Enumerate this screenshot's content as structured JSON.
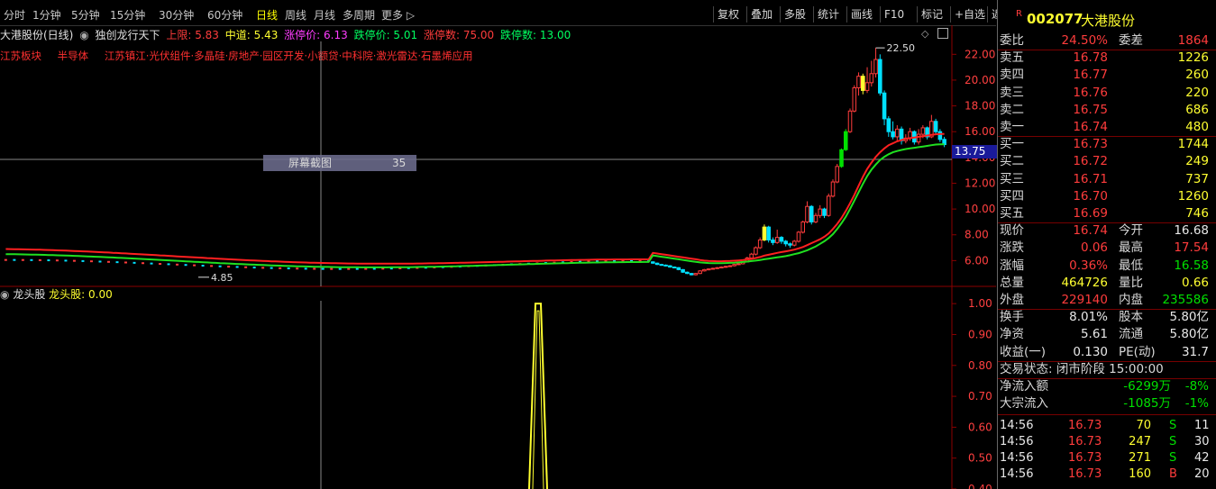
{
  "toolbar": {
    "tabs": [
      "分时",
      "1分钟",
      "5分钟",
      "15分钟",
      "30分钟",
      "60分钟",
      "日线",
      "周线",
      "月线",
      "多周期",
      "更多 ▷"
    ],
    "active_tab": "日线",
    "buttons": [
      "复权",
      "叠加",
      "多股",
      "统计",
      "画线",
      "F10",
      "标记",
      "+自选",
      "返回"
    ]
  },
  "chart_header": {
    "stock": "大港股份(日线)",
    "indicator": "独创龙行天下",
    "upper": "上限: 5.83",
    "middle": "中道: 5.43",
    "limit_up_price": "涨停价: 6.13",
    "limit_down_price": "跌停价: 5.01",
    "limit_up_count": "涨停数: 75.00",
    "limit_down_count": "跌停数: 13.00"
  },
  "sectors": [
    "江苏板块",
    "半导体",
    "江苏镇江·光伏组件·多晶硅·房地产·园区开发·小额贷·中科院·激光雷达·石墨烯应用"
  ],
  "tooltip": {
    "label": "屏幕截图",
    "value": "35"
  },
  "price_marks": {
    "high": "22.50",
    "low": "4.85",
    "current": "13.75"
  },
  "price_axis": [
    "22.00",
    "20.00",
    "18.00",
    "16.00",
    "14.00",
    "12.00",
    "10.00",
    "8.00",
    "6.00"
  ],
  "osc_header": {
    "name": "龙头股",
    "value": "龙头股: 0.00"
  },
  "osc_axis": [
    "1.00",
    "0.90",
    "0.80",
    "0.70",
    "0.60",
    "0.50",
    "0.40"
  ],
  "colors": {
    "up": "#ff3c3c",
    "down": "#00e0ff",
    "ma_red": "#ff2020",
    "ma_green": "#20e020",
    "osc": "#ffff30"
  },
  "chart_data": {
    "type": "candlestick",
    "y_range": [
      4.0,
      23.0
    ],
    "candles": [
      [
        5.9,
        5.8,
        5.95,
        5.75
      ],
      [
        5.8,
        5.7,
        5.85,
        5.65
      ],
      [
        5.7,
        5.65,
        5.75,
        5.6
      ],
      [
        5.65,
        5.6,
        5.7,
        5.55
      ],
      [
        5.6,
        5.5,
        5.65,
        5.45
      ],
      [
        5.5,
        5.45,
        5.55,
        5.4
      ],
      [
        5.45,
        5.3,
        5.5,
        5.25
      ],
      [
        5.3,
        5.1,
        5.35,
        5.05
      ],
      [
        5.1,
        5.0,
        5.15,
        4.95
      ],
      [
        5.0,
        4.9,
        5.05,
        4.85
      ],
      [
        4.9,
        5.0,
        5.05,
        4.85
      ],
      [
        5.0,
        5.2,
        5.25,
        4.95
      ],
      [
        5.2,
        5.3,
        5.35,
        5.15
      ],
      [
        5.3,
        5.35,
        5.4,
        5.25
      ],
      [
        5.35,
        5.4,
        5.45,
        5.3
      ],
      [
        5.4,
        5.45,
        5.5,
        5.35
      ],
      [
        5.45,
        5.5,
        5.55,
        5.4
      ],
      [
        5.5,
        5.55,
        5.6,
        5.45
      ],
      [
        5.55,
        5.6,
        5.65,
        5.5
      ],
      [
        5.6,
        5.7,
        5.75,
        5.55
      ],
      [
        5.7,
        5.75,
        5.8,
        5.65
      ],
      [
        5.75,
        5.9,
        5.95,
        5.7
      ],
      [
        5.9,
        6.2,
        6.3,
        5.85
      ],
      [
        6.2,
        6.5,
        6.6,
        6.1
      ],
      [
        6.5,
        7.0,
        7.1,
        6.4
      ],
      [
        7.0,
        7.6,
        7.8,
        6.9
      ],
      [
        7.6,
        8.6,
        8.8,
        7.5
      ],
      [
        8.6,
        7.6,
        8.7,
        7.4
      ],
      [
        7.6,
        7.4,
        7.8,
        7.2
      ],
      [
        7.4,
        7.8,
        8.4,
        7.3
      ],
      [
        7.8,
        7.5,
        7.9,
        7.3
      ],
      [
        7.5,
        7.3,
        7.6,
        7.1
      ],
      [
        7.3,
        7.2,
        7.4,
        7.0
      ],
      [
        7.2,
        7.5,
        7.6,
        7.1
      ],
      [
        7.5,
        8.2,
        8.3,
        7.4
      ],
      [
        8.2,
        9.0,
        9.1,
        8.1
      ],
      [
        9.0,
        10.2,
        10.6,
        8.9
      ],
      [
        10.2,
        9.0,
        10.3,
        8.8
      ],
      [
        9.0,
        9.5,
        9.7,
        8.9
      ],
      [
        9.5,
        10.0,
        10.3,
        9.3
      ],
      [
        10.0,
        9.5,
        10.1,
        9.3
      ],
      [
        9.5,
        11.0,
        11.2,
        9.4
      ],
      [
        11.0,
        12.1,
        12.3,
        10.9
      ],
      [
        12.1,
        13.3,
        13.5,
        12.0
      ],
      [
        13.3,
        14.6,
        14.7,
        13.2
      ],
      [
        14.6,
        16.0,
        16.2,
        14.5
      ],
      [
        16.0,
        17.6,
        17.8,
        15.9
      ],
      [
        17.6,
        19.4,
        19.6,
        17.5
      ],
      [
        19.4,
        20.3,
        20.6,
        18.8
      ],
      [
        20.3,
        19.2,
        20.5,
        18.9
      ],
      [
        19.2,
        19.8,
        21.0,
        19.0
      ],
      [
        19.8,
        20.5,
        21.5,
        19.5
      ],
      [
        20.5,
        21.6,
        22.5,
        20.2
      ],
      [
        21.6,
        19.0,
        22.0,
        18.8
      ],
      [
        19.0,
        17.0,
        19.2,
        16.5
      ],
      [
        17.0,
        16.0,
        17.2,
        15.6
      ],
      [
        16.0,
        15.6,
        16.8,
        15.4
      ],
      [
        15.6,
        16.2,
        16.5,
        15.2
      ],
      [
        16.2,
        15.3,
        16.4,
        15.0
      ],
      [
        15.3,
        15.5,
        15.8,
        15.1
      ],
      [
        15.5,
        16.0,
        16.3,
        15.3
      ],
      [
        16.0,
        15.2,
        16.1,
        15.0
      ],
      [
        15.2,
        15.8,
        16.2,
        15.0
      ],
      [
        15.8,
        16.3,
        16.5,
        15.5
      ],
      [
        16.3,
        15.6,
        16.4,
        15.4
      ],
      [
        15.6,
        16.8,
        17.3,
        15.5
      ],
      [
        16.8,
        16.0,
        17.0,
        15.8
      ],
      [
        16.0,
        15.4,
        16.2,
        15.2
      ],
      [
        15.4,
        15.0,
        15.6,
        14.8
      ]
    ],
    "ma_red": [
      6.6,
      6.55,
      6.5,
      6.45,
      6.4,
      6.35,
      6.3,
      6.25,
      6.2,
      6.15,
      6.1,
      6.05,
      6.0,
      5.98,
      5.96,
      5.95,
      5.95,
      5.96,
      5.97,
      5.99,
      6.01,
      6.04,
      6.08,
      6.13,
      6.2,
      6.28,
      6.38,
      6.45,
      6.52,
      6.6,
      6.66,
      6.72,
      6.78,
      6.85,
      6.95,
      7.05,
      7.2,
      7.35,
      7.5,
      7.65,
      7.85,
      8.1,
      8.45,
      8.85,
      9.3,
      9.85,
      10.45,
      11.1,
      11.8,
      12.5,
      13.1,
      13.6,
      14.05,
      14.4,
      14.7,
      14.95,
      15.1,
      15.25,
      15.35,
      15.45,
      15.5,
      15.55,
      15.6,
      15.65,
      15.7,
      15.75,
      15.8,
      15.82,
      15.82
    ],
    "ma_green": [
      6.4,
      6.35,
      6.3,
      6.25,
      6.2,
      6.15,
      6.1,
      6.05,
      6.0,
      5.95,
      5.9,
      5.86,
      5.83,
      5.81,
      5.8,
      5.8,
      5.8,
      5.81,
      5.82,
      5.84,
      5.86,
      5.89,
      5.92,
      5.96,
      6.0,
      6.05,
      6.1,
      6.15,
      6.2,
      6.25,
      6.3,
      6.35,
      6.42,
      6.5,
      6.58,
      6.68,
      6.8,
      6.95,
      7.1,
      7.3,
      7.5,
      7.75,
      8.05,
      8.45,
      8.9,
      9.4,
      10.0,
      10.65,
      11.3,
      11.95,
      12.55,
      13.05,
      13.45,
      13.8,
      14.05,
      14.25,
      14.4,
      14.5,
      14.58,
      14.65,
      14.7,
      14.75,
      14.8,
      14.85,
      14.9,
      14.95,
      15.0,
      15.02,
      15.02
    ],
    "osc_range": [
      0.4,
      1.05
    ],
    "osc_spike_value": 1.0
  },
  "panel": {
    "code": "002077",
    "name": "大港股份",
    "weibi": {
      "label": "委比",
      "value": "24.50%",
      "label2": "委差",
      "value2": "1864"
    },
    "asks": [
      {
        "label": "卖五",
        "price": "16.78",
        "vol": "1226"
      },
      {
        "label": "卖四",
        "price": "16.77",
        "vol": "260"
      },
      {
        "label": "卖三",
        "price": "16.76",
        "vol": "220"
      },
      {
        "label": "卖二",
        "price": "16.75",
        "vol": "686"
      },
      {
        "label": "卖一",
        "price": "16.74",
        "vol": "480"
      }
    ],
    "bids": [
      {
        "label": "买一",
        "price": "16.73",
        "vol": "1744"
      },
      {
        "label": "买二",
        "price": "16.72",
        "vol": "249"
      },
      {
        "label": "买三",
        "price": "16.71",
        "vol": "737"
      },
      {
        "label": "买四",
        "price": "16.70",
        "vol": "1260"
      },
      {
        "label": "买五",
        "price": "16.69",
        "vol": "746"
      }
    ],
    "stats": [
      {
        "l": "现价",
        "v": "16.74",
        "l2": "今开",
        "v2": "16.68",
        "c1": "red",
        "c2": "white"
      },
      {
        "l": "涨跌",
        "v": "0.06",
        "l2": "最高",
        "v2": "17.54",
        "c1": "red",
        "c2": "red"
      },
      {
        "l": "涨幅",
        "v": "0.36%",
        "l2": "最低",
        "v2": "16.58",
        "c1": "red",
        "c2": "green"
      },
      {
        "l": "总量",
        "v": "464726",
        "l2": "量比",
        "v2": "0.66",
        "c1": "yellow",
        "c2": "yellow"
      },
      {
        "l": "外盘",
        "v": "229140",
        "l2": "内盘",
        "v2": "235586",
        "c1": "red",
        "c2": "green"
      }
    ],
    "stats2": [
      {
        "l": "换手",
        "v": "8.01%",
        "l2": "股本",
        "v2": "5.80亿"
      },
      {
        "l": "净资",
        "v": "5.61",
        "l2": "流通",
        "v2": "5.80亿"
      },
      {
        "l": "收益(一)",
        "v": "0.130",
        "l2": "PE(动)",
        "v2": "31.7"
      }
    ],
    "trade_status": "交易状态: 闭市阶段 15:00:00",
    "flows": [
      {
        "l": "净流入额",
        "v": "-6299万",
        "p": "-8%"
      },
      {
        "l": "大宗流入",
        "v": "-1085万",
        "p": "-1%"
      }
    ],
    "ticks": [
      {
        "t": "14:56",
        "p": "16.73",
        "v": "70",
        "s": "S",
        "n": "11"
      },
      {
        "t": "14:56",
        "p": "16.73",
        "v": "247",
        "s": "S",
        "n": "30"
      },
      {
        "t": "14:56",
        "p": "16.73",
        "v": "271",
        "s": "S",
        "n": "42"
      },
      {
        "t": "14:56",
        "p": "16.73",
        "v": "160",
        "s": "B",
        "n": "20"
      }
    ]
  }
}
